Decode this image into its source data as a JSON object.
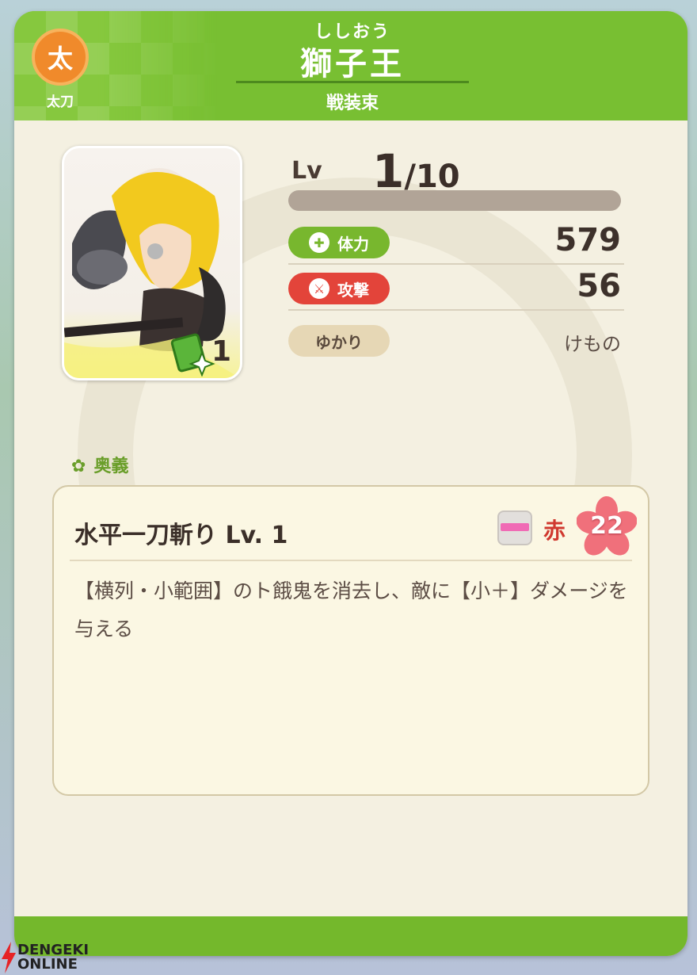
{
  "header": {
    "weapon_type_icon": "太",
    "weapon_type_label": "太刀",
    "reading": "ししおう",
    "name": "獅子王",
    "subtitle": "戦装束"
  },
  "portrait": {
    "badge_count": "1",
    "badge_icon": "book-sparkle-icon"
  },
  "level": {
    "label": "Lv",
    "current": "1",
    "max": "/10",
    "progress": 0
  },
  "stats": {
    "hp": {
      "label": "体力",
      "value": "579",
      "color": "#78b72e",
      "icon": "heart-plus-icon"
    },
    "atk": {
      "label": "攻撃",
      "value": "56",
      "color": "#e3443a",
      "icon": "sword-icon"
    },
    "yukari": {
      "label": "ゆかり",
      "value": "けもの",
      "color": "#e6d7b5"
    }
  },
  "ougi": {
    "section_label": "奥義",
    "skill_name": "水平一刀斬り Lv. 1",
    "color_label": "赤",
    "cost": "22",
    "description": "【横列・小範囲】のト餓鬼を消去し、敵に【小＋】ダメージを与える"
  },
  "watermark": {
    "line1": "DENGEKI",
    "line2": "ONLINE"
  }
}
